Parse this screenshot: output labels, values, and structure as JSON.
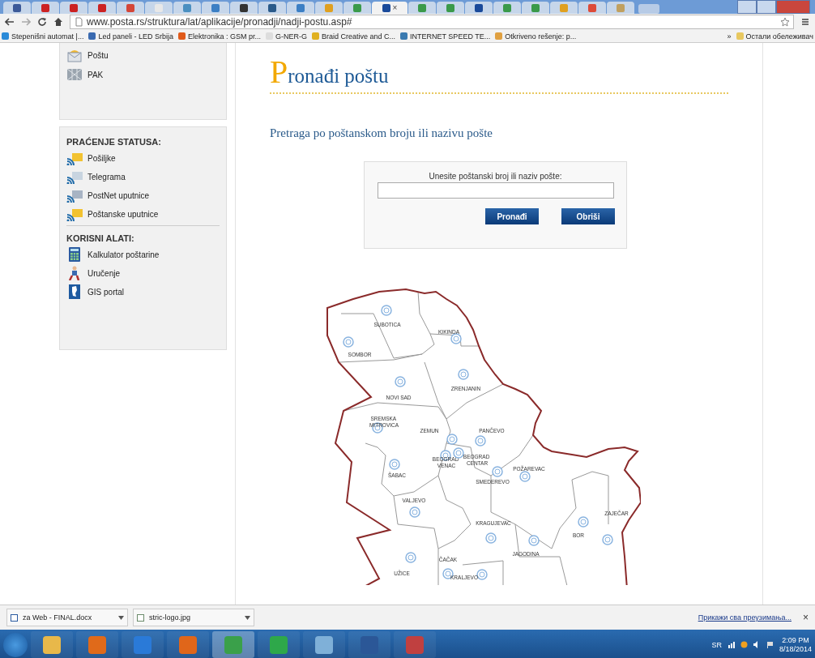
{
  "tabstrip": {
    "tabs": [
      {
        "selected": false,
        "color": "#3b5998"
      },
      {
        "selected": false,
        "color": "#cc2222"
      },
      {
        "selected": false,
        "color": "#cc2222"
      },
      {
        "selected": false,
        "color": "#cc2222"
      },
      {
        "selected": false,
        "color": "#d44638"
      },
      {
        "selected": false,
        "color": "#e8e8e8"
      },
      {
        "selected": false,
        "color": "#4a8fc0"
      },
      {
        "selected": false,
        "color": "#3c7fc4"
      },
      {
        "selected": false,
        "color": "#333333"
      },
      {
        "selected": false,
        "color": "#2a5a8a"
      },
      {
        "selected": false,
        "color": "#3c7fc4"
      },
      {
        "selected": false,
        "color": "#e0a020"
      },
      {
        "selected": false,
        "color": "#3a9a4a"
      },
      {
        "selected": true,
        "color": "#1a4a9a"
      },
      {
        "selected": false,
        "color": "#3a9a4a"
      },
      {
        "selected": false,
        "color": "#3a9a4a"
      },
      {
        "selected": false,
        "color": "#1a4a9a"
      },
      {
        "selected": false,
        "color": "#3a9a4a"
      },
      {
        "selected": false,
        "color": "#3a9a4a"
      },
      {
        "selected": false,
        "color": "#e0a020"
      },
      {
        "selected": false,
        "color": "#dd4b39"
      },
      {
        "selected": false,
        "color": "#c0a060"
      }
    ],
    "close_label": "×"
  },
  "toolbar": {
    "url": "www.posta.rs/struktura/lat/aplikacije/pronadji/nadji-postu.asp#"
  },
  "bookmarks": {
    "items": [
      "Stepenišni automat |...",
      "Led paneli - LED Srbija",
      "Elektronika : GSM pr...",
      "G-NER-G",
      "Braid Creative and C...",
      "INTERNET SPEED TE...",
      "Otkriveno rešenje: p..."
    ],
    "more": "»",
    "other": "Остали обележивач"
  },
  "sidebar": {
    "top_items": [
      "Poštu",
      "PAK"
    ],
    "groups": [
      {
        "heading": "PRAĆENJE STATUSA:",
        "items": [
          "Pošiljke",
          "Telegrama",
          "PostNet uputnice",
          "Poštanske uputnice"
        ]
      },
      {
        "heading": "KORISNI ALATI:",
        "items": [
          "Kalkulator poštarine",
          "Uručenje",
          "GIS portal"
        ]
      }
    ]
  },
  "main": {
    "title": "Pronađi poštu",
    "subtitle": "Pretraga po poštanskom broju ili nazivu pošte",
    "search": {
      "label": "Unesite poštanski broj ili naziv pošte:",
      "buttons": [
        "Pronađi",
        "Obriši"
      ]
    },
    "map": {
      "cities": [
        "SUBOTICA",
        "KIKINDA",
        "SOMBOR",
        "NOVI SAD",
        "ZRENJANIN",
        "SREMSKA MITROVICA",
        "ZEMUN",
        "PANČEVO",
        "BEOGRAD VENAC",
        "BEOGRAD CENTAR",
        "ŠABAC",
        "POŽAREVAC",
        "SMEDEREVO",
        "VALJEVO",
        "KRAGUJEVAC",
        "BOR",
        "ZAJEČAR",
        "JAGODINA",
        "UŽICE",
        "ČAČAK",
        "KRALJEVO"
      ]
    }
  },
  "downloads": {
    "items": [
      "za Web - FINAL.docx",
      "stric-logo.jpg"
    ],
    "show_all": "Прикажи сва преузимања...",
    "close": "×"
  },
  "taskbar": {
    "apps": [
      {
        "color": "#e8b84a",
        "selected": false
      },
      {
        "color": "#e06a1a",
        "selected": false
      },
      {
        "color": "#2a7ad8",
        "selected": false
      },
      {
        "color": "#e0661a",
        "selected": false
      },
      {
        "color": "#3aa04a",
        "selected": true
      },
      {
        "color": "#2ea84a",
        "selected": false
      },
      {
        "color": "#7fb0d8",
        "selected": false
      },
      {
        "color": "#2b5797",
        "selected": false
      },
      {
        "color": "#c04040",
        "selected": false
      }
    ],
    "language": "SR",
    "time": "2:09 PM",
    "date": "8/18/2014"
  }
}
